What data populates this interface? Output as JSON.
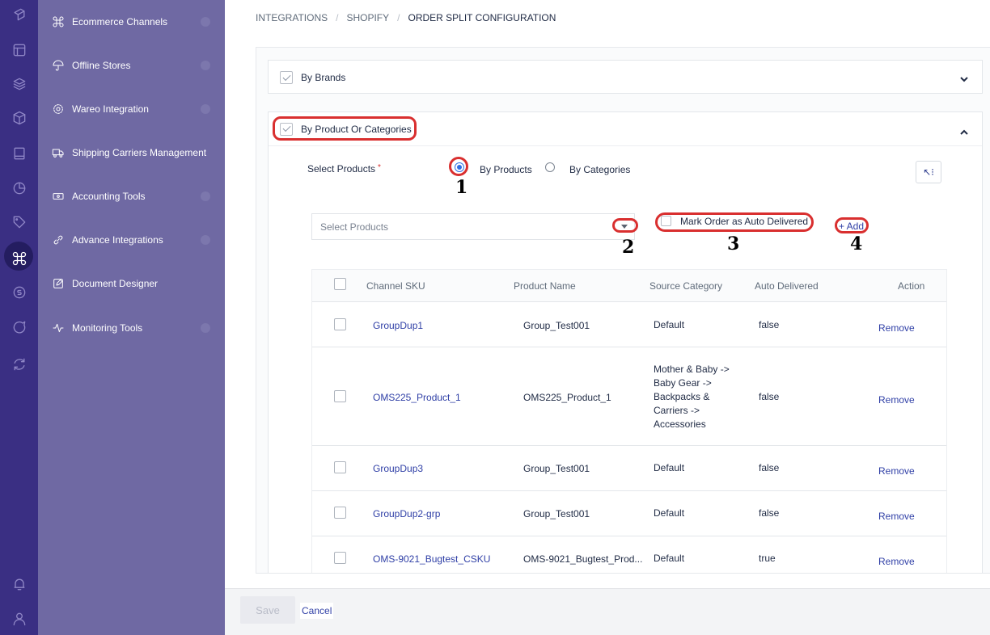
{
  "rail": {
    "icons": [
      "logo-icon",
      "layout-icon",
      "layers-icon",
      "box-icon",
      "book-icon",
      "pie-chart-icon",
      "tag-icon",
      "command-icon",
      "currency-icon",
      "chat-icon",
      "refresh-icon",
      "bell-icon",
      "user-icon"
    ],
    "active": "command-icon"
  },
  "sidebar": {
    "items": [
      {
        "label": "Ecommerce Channels",
        "icon": "command-icon"
      },
      {
        "label": "Offline Stores",
        "icon": "umbrella-icon"
      },
      {
        "label": "Wareo Integration",
        "icon": "settings-icon"
      },
      {
        "label": "Shipping Carriers Management",
        "icon": "truck-icon"
      },
      {
        "label": "Accounting Tools",
        "icon": "money-icon"
      },
      {
        "label": "Advance Integrations",
        "icon": "link-icon"
      },
      {
        "label": "Document Designer",
        "icon": "edit-icon"
      },
      {
        "label": "Monitoring Tools",
        "icon": "activity-icon"
      }
    ]
  },
  "breadcrumb": {
    "items": [
      "INTEGRATIONS",
      "SHOPIFY",
      "ORDER SPLIT CONFIGURATION"
    ],
    "separator": "/"
  },
  "sections": {
    "brands": {
      "label": "By Brands"
    },
    "products": {
      "label": "By Product Or Categories"
    }
  },
  "form": {
    "select_products_label": "Select Products",
    "required_mark": "*",
    "radio_products": "By Products",
    "radio_categories": "By Categories",
    "selected_radio": "By Products",
    "select_placeholder": "Select Products",
    "auto_delivered_label": "Mark Order as Auto Delivered",
    "add_label": "+ Add",
    "collapse_button": "↖⁝"
  },
  "annotations": [
    "1",
    "2",
    "3",
    "4"
  ],
  "table": {
    "columns": [
      "Channel SKU",
      "Product Name",
      "Source Category",
      "Auto Delivered",
      "Action"
    ],
    "rows": [
      {
        "sku": "GroupDup1",
        "product": "Group_Test001",
        "category": "Default",
        "auto": "false",
        "action": "Remove"
      },
      {
        "sku": "OMS225_Product_1",
        "product": "OMS225_Product_1",
        "category": "Mother & Baby -> Baby Gear -> Backpacks & Carriers -> Accessories",
        "auto": "false",
        "action": "Remove"
      },
      {
        "sku": "GroupDup3",
        "product": "Group_Test001",
        "category": "Default",
        "auto": "false",
        "action": "Remove"
      },
      {
        "sku": "GroupDup2-grp",
        "product": "Group_Test001",
        "category": "Default",
        "auto": "false",
        "action": "Remove"
      },
      {
        "sku": "OMS-9021_Bugtest_CSKU",
        "product": "OMS-9021_Bugtest_Prod...",
        "category": "Default",
        "auto": "true",
        "action": "Remove"
      }
    ]
  },
  "footer": {
    "save": "Save",
    "cancel": "Cancel"
  },
  "colors": {
    "rail": "#3a2f83",
    "sidebar": "#6f69a3",
    "link": "#2f3fa6",
    "highlight": "#d92f2f",
    "radio_selected": "#2f6fe4"
  }
}
